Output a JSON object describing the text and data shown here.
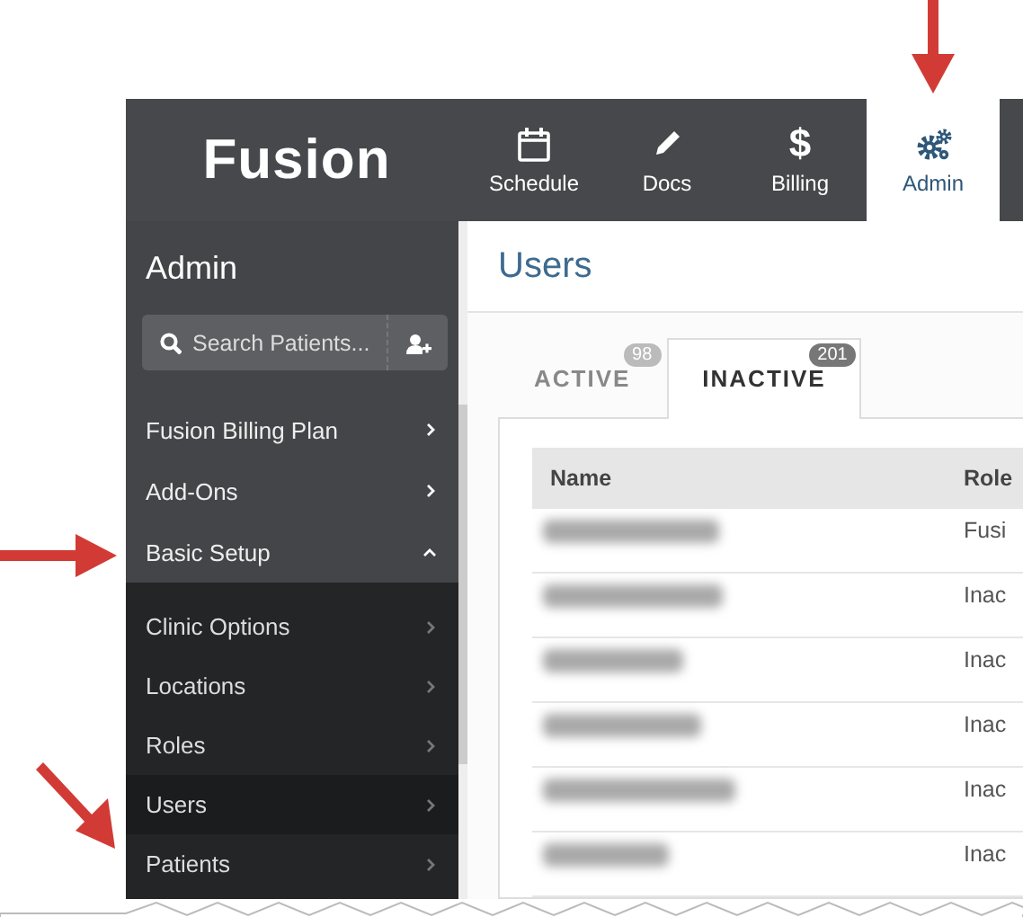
{
  "app": {
    "logo": "Fusion"
  },
  "nav": [
    {
      "label": "Schedule",
      "kind": "calendar",
      "selected": false
    },
    {
      "label": "Docs",
      "kind": "pencil",
      "selected": false
    },
    {
      "label": "Billing",
      "kind": "glyph",
      "glyph": "$",
      "selected": false
    },
    {
      "label": "Admin",
      "kind": "gears",
      "selected": true
    }
  ],
  "sidebar": {
    "title": "Admin",
    "search": {
      "placeholder": "Search Patients..."
    },
    "items": [
      {
        "label": "Fusion Billing Plan",
        "expanded": false
      },
      {
        "label": "Add-Ons",
        "expanded": false
      },
      {
        "label": "Basic Setup",
        "expanded": true,
        "children": [
          {
            "label": "Clinic Options",
            "selected": false
          },
          {
            "label": "Locations",
            "selected": false
          },
          {
            "label": "Roles",
            "selected": false
          },
          {
            "label": "Users",
            "selected": true
          },
          {
            "label": "Patients",
            "selected": false
          }
        ]
      }
    ]
  },
  "page": {
    "title": "Users",
    "tabs": [
      {
        "label": "ACTIVE",
        "count": "98",
        "selected": false
      },
      {
        "label": "INACTIVE",
        "count": "201",
        "selected": true
      }
    ],
    "table": {
      "columns": [
        "Name",
        "Role"
      ],
      "rows": [
        {
          "name_blurred": true,
          "role": "Fusi"
        },
        {
          "name_blurred": true,
          "role": "Inac"
        },
        {
          "name_blurred": true,
          "role": "Inac"
        },
        {
          "name_blurred": true,
          "role": "Inac"
        },
        {
          "name_blurred": true,
          "role": "Inac"
        },
        {
          "name_blurred": true,
          "role": "Inac"
        }
      ]
    }
  }
}
